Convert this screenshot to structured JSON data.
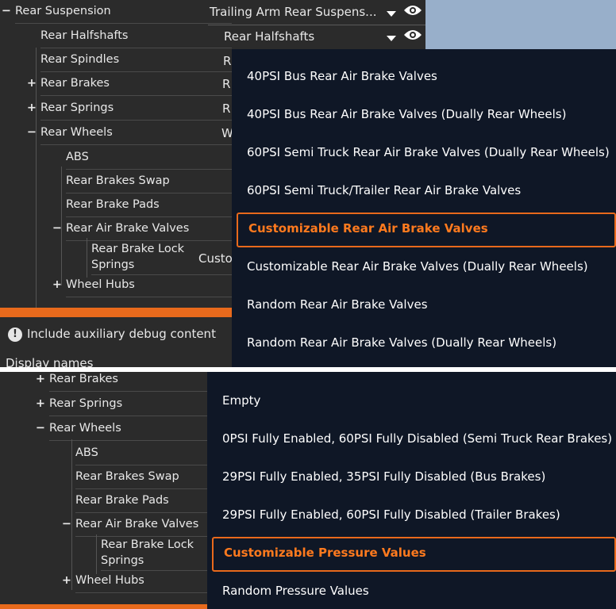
{
  "top": {
    "tree": [
      {
        "glyph": "−",
        "label": "Rear Suspension"
      },
      {
        "glyph": "",
        "label": "Rear Halfshafts"
      },
      {
        "glyph": "",
        "label": "Rear Spindles"
      },
      {
        "glyph": "+",
        "label": "Rear Brakes"
      },
      {
        "glyph": "+",
        "label": "Rear Springs"
      },
      {
        "glyph": "−",
        "label": "Rear Wheels"
      },
      {
        "glyph": "",
        "label": "ABS"
      },
      {
        "glyph": "",
        "label": "Rear Brakes Swap"
      },
      {
        "glyph": "",
        "label": "Rear Brake Pads"
      },
      {
        "glyph": "−",
        "label": "Rear Air Brake Valves"
      },
      {
        "glyph": "",
        "label": "Rear Brake Lock",
        "label2": "Springs"
      },
      {
        "glyph": "+",
        "label": "Wheel Hubs"
      }
    ],
    "values": {
      "suspension": "Trailing Arm Rear Suspens...",
      "halfshafts": "Rear Halfshafts",
      "partials": [
        "R",
        "R",
        "R",
        "W"
      ],
      "lock_springs_partial": "Custo"
    },
    "dropdown": {
      "items": [
        "40PSI Bus Rear Air Brake Valves",
        "40PSI Bus Rear Air Brake Valves (Dually Rear Wheels)",
        "60PSI Semi Truck Rear Air Brake Valves (Dually Rear Wheels)",
        "60PSI Semi Truck/Trailer Rear Air Brake Valves",
        "Customizable Rear Air Brake Valves",
        "Customizable Rear Air Brake Valves (Dually Rear Wheels)",
        "Random Rear Air Brake Valves",
        "Random Rear Air Brake Valves (Dually Rear Wheels)"
      ],
      "selected_index": 4
    },
    "debug_label": "Include auxiliary debug content",
    "display_names": "Display names"
  },
  "bottom": {
    "tree": [
      {
        "glyph": "+",
        "label": "Rear Brakes"
      },
      {
        "glyph": "+",
        "label": "Rear Springs"
      },
      {
        "glyph": "−",
        "label": "Rear Wheels"
      },
      {
        "glyph": "",
        "label": "ABS"
      },
      {
        "glyph": "",
        "label": "Rear Brakes Swap"
      },
      {
        "glyph": "",
        "label": "Rear Brake Pads"
      },
      {
        "glyph": "−",
        "label": "Rear Air Brake Valves"
      },
      {
        "glyph": "",
        "label": "Rear Brake Lock",
        "label2": "Springs"
      },
      {
        "glyph": "+",
        "label": "Wheel Hubs"
      }
    ],
    "dropdown": {
      "items": [
        "Empty",
        "0PSI Fully Enabled, 60PSI Fully Disabled (Semi Truck Rear Brakes)",
        "29PSI Fully Enabled, 35PSI Fully Disabled (Bus Brakes)",
        "29PSI Fully Enabled, 60PSI Fully Disabled (Trailer Brakes)",
        "Customizable Pressure Values",
        "Random Pressure Values"
      ],
      "selected_index": 4
    }
  },
  "colors": {
    "panel_bg": "#2b2b2b",
    "dropdown_bg": "#0f1726",
    "accent": "#e8691c",
    "sky": "#98afca"
  },
  "icons": {
    "visibility": "eye-icon",
    "expand": "plus-icon",
    "collapse": "minus-icon",
    "info": "info-icon",
    "caret": "chevron-down-icon"
  }
}
